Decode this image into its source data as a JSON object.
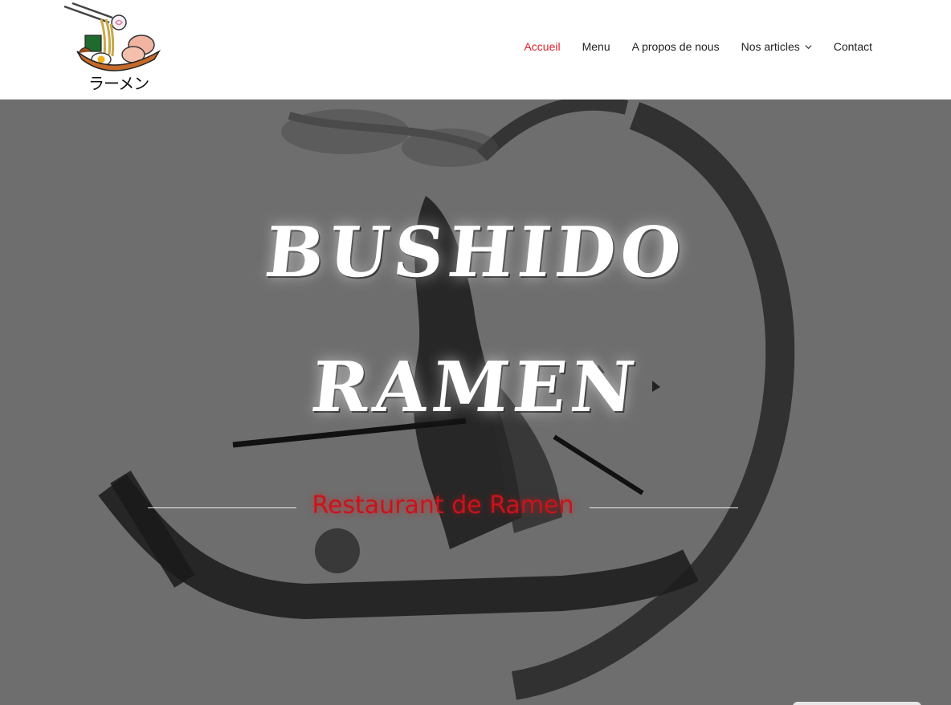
{
  "header": {
    "logo_text": "ラーメン",
    "nav": [
      {
        "label": "Accueil",
        "active": true
      },
      {
        "label": "Menu",
        "active": false
      },
      {
        "label": "A propos de nous",
        "active": false
      },
      {
        "label": "Nos articles",
        "active": false,
        "has_dropdown": true
      },
      {
        "label": "Contact",
        "active": false
      }
    ]
  },
  "hero": {
    "title_line1": "BUSHIDO",
    "title_line2": "RAMEN",
    "subtitle": "Restaurant de Ramen"
  },
  "colors": {
    "accent": "#e0202a",
    "subtitle": "#c8141c",
    "hero_bg": "#6e6e6e"
  }
}
